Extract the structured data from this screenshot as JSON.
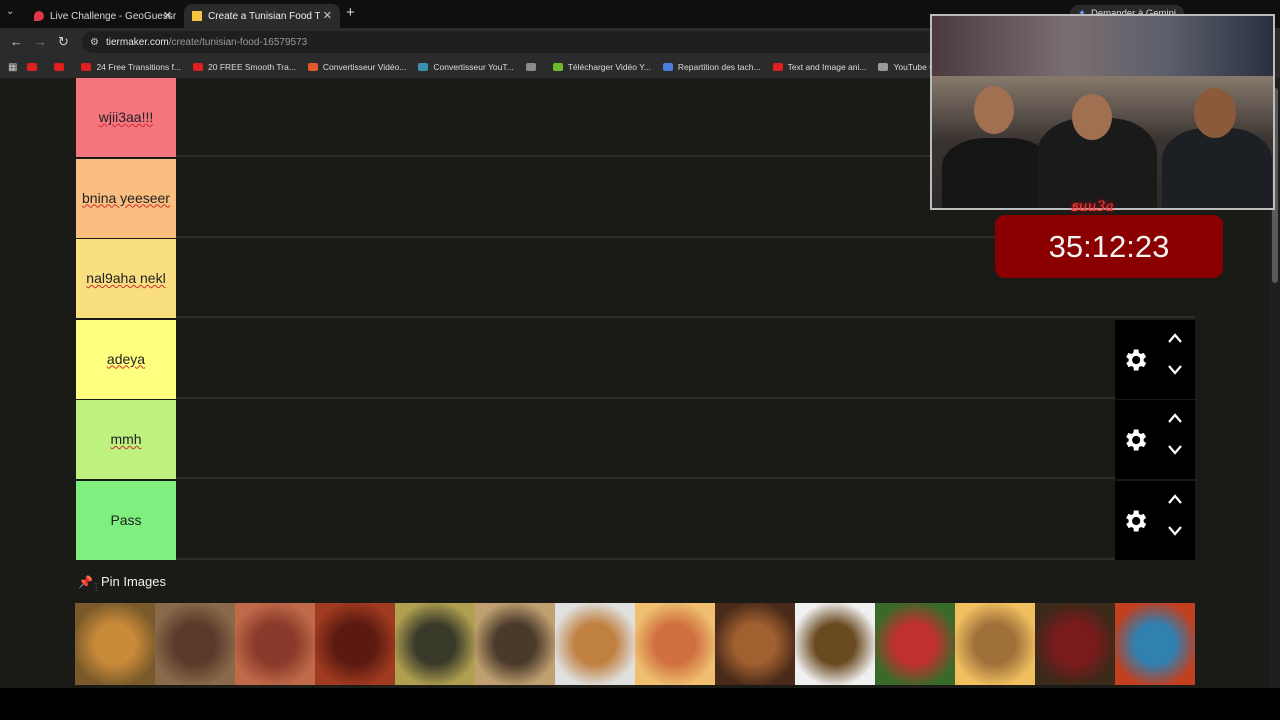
{
  "browser": {
    "tabs": [
      {
        "title": "Live Challenge - GeoGuessr",
        "favicon_color": "#e0374a"
      },
      {
        "title": "Create a Tunisian Food Tier List",
        "favicon_color": "#f5c542"
      }
    ],
    "new_tab_symbol": "+",
    "gemini_label": "Demander à Gemini",
    "url_host": "tiermaker.com",
    "url_path": "/create/tunisian-food-16579573",
    "bookmarks": [
      {
        "label": "",
        "color": "#e02020"
      },
      {
        "label": "",
        "color": "#e02020"
      },
      {
        "label": "24 Free Transitions f...",
        "color": "#e02020"
      },
      {
        "label": "20 FREE Smooth Tra...",
        "color": "#e02020"
      },
      {
        "label": "Convertisseur Vidéo...",
        "color": "#e2582a"
      },
      {
        "label": "Convertisseur YouT...",
        "color": "#3a8fb0"
      },
      {
        "label": "",
        "color": "#8a8a8a"
      },
      {
        "label": "Télécharger Vidéo Y...",
        "color": "#6dbb2a"
      },
      {
        "label": "Repartition des tach...",
        "color": "#4a7fe0"
      },
      {
        "label": "Text and Image ani...",
        "color": "#e02020"
      },
      {
        "label": "YouTube Converter...",
        "color": "#9a9a9a"
      }
    ]
  },
  "tiers": [
    {
      "label": "wjii3aa!!!",
      "color": "#f4757e",
      "controls": false
    },
    {
      "label": "bnina yeeseer",
      "color": "#f9be80",
      "controls": false
    },
    {
      "label": "nal9aha nekl",
      "color": "#fadf80",
      "controls": false
    },
    {
      "label": "adeya",
      "color": "#fefe7f",
      "controls": true
    },
    {
      "label": "mmh",
      "color": "#bff17f",
      "controls": true
    },
    {
      "label": "Pass",
      "color": "#7fef7f",
      "controls": true
    }
  ],
  "pin_images": {
    "title": "Pin Images",
    "items": [
      {
        "name": "couscous",
        "colors": [
          "#c98a3a",
          "#7a5a2a"
        ]
      },
      {
        "name": "grilled-meat",
        "colors": [
          "#5a3a2a",
          "#8a6a4a"
        ]
      },
      {
        "name": "stew",
        "colors": [
          "#8a3a2a",
          "#c06a4a"
        ]
      },
      {
        "name": "ojja",
        "colors": [
          "#5a1a10",
          "#a03a20"
        ]
      },
      {
        "name": "pan-dish",
        "colors": [
          "#3a3a2a",
          "#b0a050"
        ]
      },
      {
        "name": "bread",
        "colors": [
          "#4a3a2a",
          "#c0a070"
        ]
      },
      {
        "name": "soup",
        "colors": [
          "#c08040",
          "#e0e0e0"
        ]
      },
      {
        "name": "pizza",
        "colors": [
          "#d07040",
          "#f0c070"
        ]
      },
      {
        "name": "meat-potato",
        "colors": [
          "#a06030",
          "#4a2a1a"
        ]
      },
      {
        "name": "pasta-plate",
        "colors": [
          "#6a4a20",
          "#f0f0f0"
        ]
      },
      {
        "name": "salad",
        "colors": [
          "#c03030",
          "#3a6a2a"
        ]
      },
      {
        "name": "sandwich",
        "colors": [
          "#a0703a",
          "#f0c060"
        ]
      },
      {
        "name": "lablabi",
        "colors": [
          "#7a1a1a",
          "#3a2a1a"
        ]
      },
      {
        "name": "spaghetti",
        "colors": [
          "#3080b0",
          "#c04020"
        ]
      }
    ]
  },
  "stream": {
    "logo_text": "ธuu3a",
    "timer": "35:12:23"
  }
}
